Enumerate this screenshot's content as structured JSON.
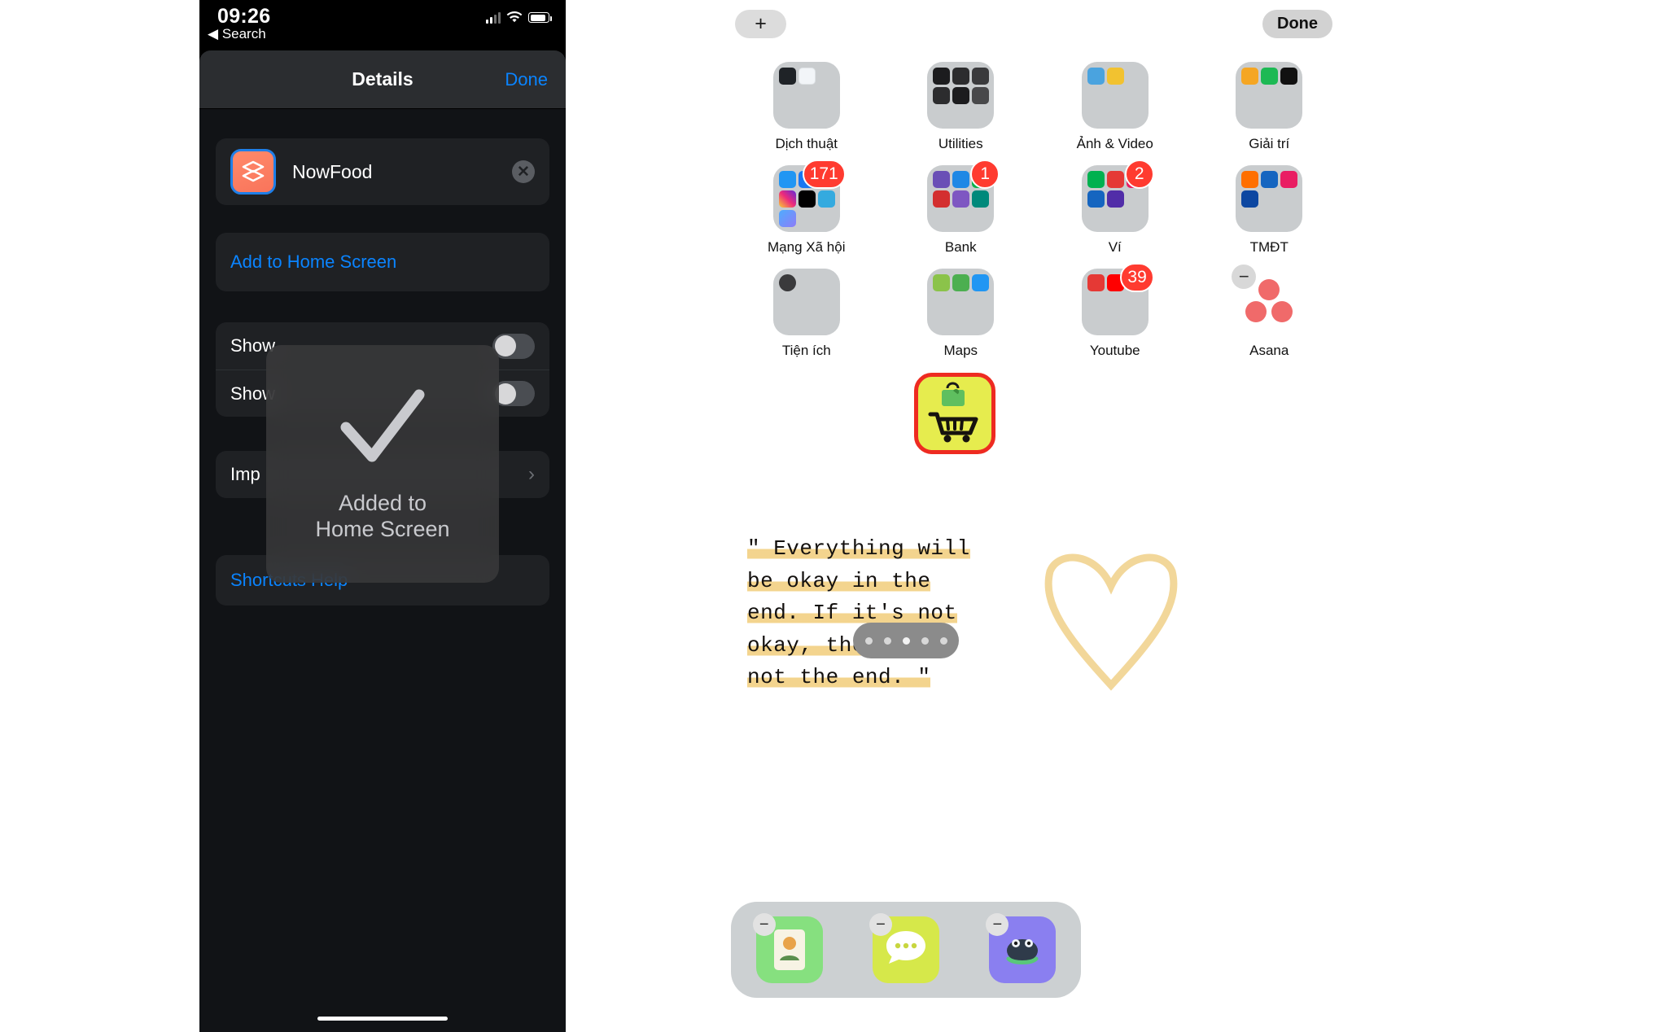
{
  "left_phone": {
    "status_bar": {
      "time": "09:26",
      "back_label": "Search",
      "back_icon": "triangle-left-icon",
      "signal_icon": "cellular-signal-icon",
      "wifi_icon": "wifi-icon",
      "battery_icon": "battery-icon"
    },
    "nav": {
      "title": "Details",
      "done_label": "Done"
    },
    "app_row": {
      "name": "NowFood",
      "icon": "shortcuts-layers-icon",
      "clear_icon": "clear-circle-icon"
    },
    "add_home": {
      "label": "Add to Home Screen"
    },
    "toggles": [
      {
        "label": "Show in Share Sheet",
        "short": "Show",
        "state": "off"
      },
      {
        "label": "Show on Apple Watch",
        "short": "Show",
        "state": "off"
      }
    ],
    "import": {
      "label": "Import Questions",
      "short": "Imp",
      "chevron_icon": "chevron-right-icon"
    },
    "help": {
      "label": "Shortcuts Help"
    },
    "hud": {
      "check_icon": "checkmark-icon",
      "line1": "Added to",
      "line2": "Home Screen"
    },
    "home_indicator": "home-indicator"
  },
  "right_phone": {
    "top": {
      "add_label": "+",
      "done_label": "Done"
    },
    "folders": [
      {
        "label": "Dịch thuật",
        "badge": "",
        "minus": false,
        "apps": [
          "#1f2327",
          "#ffffff"
        ]
      },
      {
        "label": "Utilities",
        "badge": "",
        "minus": false,
        "apps": [
          "#1c1c1e",
          "#2c2c2e",
          "#3a3a3c",
          "#2c2c2e",
          "#1c1c1e",
          "#48484a"
        ]
      },
      {
        "label": "Ảnh & Video",
        "badge": "",
        "minus": false,
        "apps": [
          "#4aa3df",
          "#f2c230"
        ]
      },
      {
        "label": "Giải trí",
        "badge": "",
        "minus": false,
        "apps": [
          "#f5a623",
          "#1db954",
          "#e50914"
        ]
      },
      {
        "label": "Mạng Xã hội",
        "badge": "171",
        "minus": false,
        "apps": [
          "#2196f3",
          "#1877f2",
          "#1da1f2",
          "#e1306c",
          "#010101",
          "#34aadf",
          "#3b9cf5"
        ]
      },
      {
        "label": "Bank",
        "badge": "1",
        "minus": false,
        "apps": [
          "#6a4fb6",
          "#1e88e5",
          "#0db14b",
          "#d32f2f",
          "#7e57c2",
          "#00897b"
        ]
      },
      {
        "label": "Ví",
        "badge": "2",
        "minus": false,
        "apps": [
          "#00b14f",
          "#e53935",
          "#e91e63",
          "#1565c0",
          "#512da8"
        ]
      },
      {
        "label": "TMĐT",
        "badge": "",
        "minus": false,
        "apps": [
          "#ff6f00",
          "#1565c0",
          "#e91e63",
          "#0d47a1"
        ]
      },
      {
        "label": "Tiện ích",
        "badge": "",
        "minus": false,
        "apps": [
          "#3a3a3c"
        ]
      },
      {
        "label": "Maps",
        "badge": "",
        "minus": false,
        "apps": [
          "#8bc34a",
          "#4caf50",
          "#2196f3"
        ]
      },
      {
        "label": "Youtube",
        "badge": "39",
        "minus": false,
        "apps": [
          "#e53935",
          "#ff0000",
          "#c62828"
        ]
      },
      {
        "label": "Asana",
        "badge": "",
        "minus": true,
        "apps": []
      }
    ],
    "shortcut": {
      "label": "",
      "icon": "shopping-cart-icon",
      "bg_color": "#e6ec4e",
      "border_color": "#ee2b21",
      "badge_icon": "apple-bag-icon"
    },
    "quote": {
      "lines": [
        "\" Everything will",
        "be okay in the",
        "end. If it's not",
        "okay, then it's",
        "not the end. \""
      ],
      "highlight_color": "#f0c86e"
    },
    "page_dots": {
      "count": 5,
      "active_index": 2
    },
    "dock": [
      {
        "name": "dock-app-1",
        "color": "#86e07f",
        "minus": true
      },
      {
        "name": "dock-app-2",
        "color": "#d6e84a",
        "minus": true
      },
      {
        "name": "dock-app-3",
        "color": "#8a7ff0",
        "minus": true
      }
    ]
  }
}
